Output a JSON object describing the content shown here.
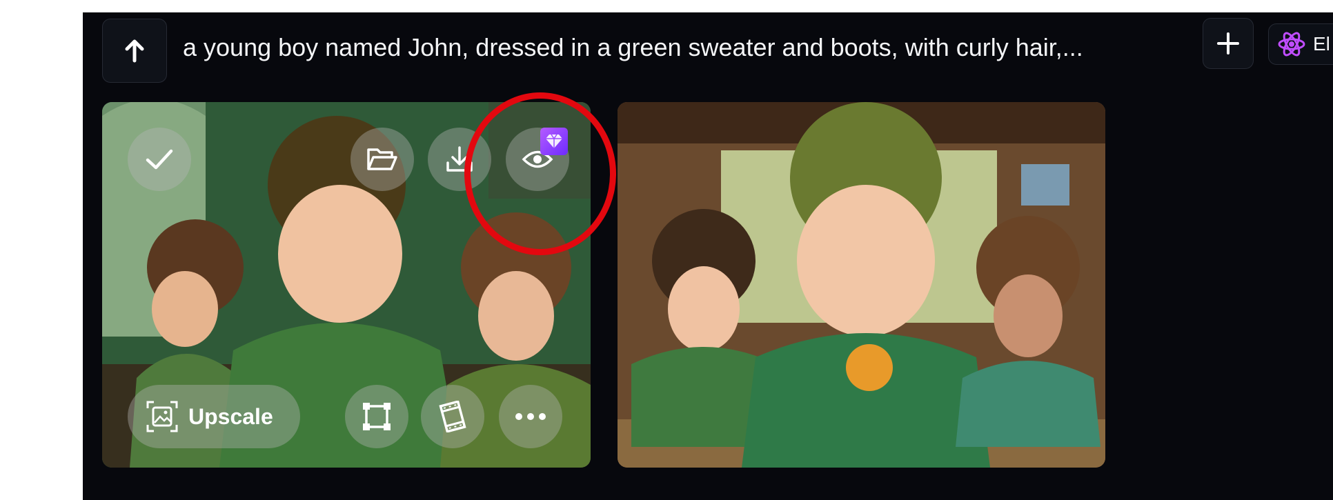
{
  "header": {
    "prompt": "a young boy named John, dressed in a green sweater and boots, with curly hair,...",
    "model_label": "El"
  },
  "icons": {
    "back": "arrow-up-icon",
    "add": "plus-icon",
    "model": "atom-icon",
    "select": "checkmark-icon",
    "folder": "folder-open-icon",
    "download": "download-icon",
    "preview": "eye-icon",
    "premium": "gem-icon",
    "upscale": "upscale-image-icon",
    "crop": "crop-frame-icon",
    "video": "film-strip-icon",
    "more": "more-horizontal-icon"
  },
  "image_card_1": {
    "upscale_label": "Upscale"
  },
  "colors": {
    "background": "#07080d",
    "highlight": "#e3080f",
    "premium": "#9b4dff"
  }
}
